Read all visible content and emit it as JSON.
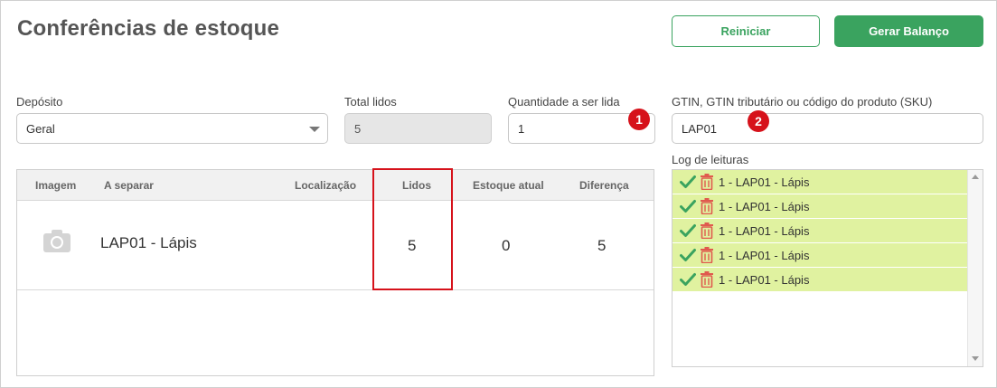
{
  "header": {
    "title": "Conferências de estoque",
    "restart_label": "Reiniciar",
    "generate_label": "Gerar Balanço"
  },
  "form": {
    "deposit_label": "Depósito",
    "deposit_value": "Geral",
    "total_read_label": "Total lidos",
    "total_read_value": "5",
    "quantity_label": "Quantidade a ser lida",
    "quantity_value": "1",
    "sku_label": "GTIN, GTIN tributário ou código do produto (SKU)",
    "sku_value": "LAP01"
  },
  "badges": [
    "1",
    "2"
  ],
  "table": {
    "columns": [
      "Imagem",
      "A separar",
      "Localização",
      "Lidos",
      "Estoque atual",
      "Diferença"
    ],
    "rows": [
      {
        "image_icon": "camera-icon",
        "item": "LAP01 -  Lápis",
        "location": "",
        "read": "5",
        "stock": "0",
        "difference": "5"
      }
    ]
  },
  "log": {
    "label": "Log de leituras",
    "entries": [
      "1 - LAP01 - Lápis",
      "1 - LAP01 - Lápis",
      "1 - LAP01 - Lápis",
      "1 - LAP01 - Lápis",
      "1 - LAP01 - Lápis"
    ],
    "entry_icons": [
      "check-icon",
      "trash-icon"
    ]
  },
  "colors": {
    "primary": "#3aa35f",
    "badge": "#d6121b",
    "log_entry_bg": "#e0f2a0",
    "check": "#3aa35f",
    "trash": "#e05a4e"
  }
}
